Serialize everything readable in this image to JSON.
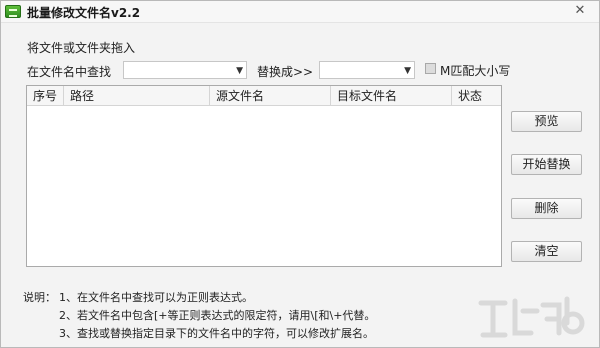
{
  "window": {
    "title": "批量修改文件名v2.2",
    "close_glyph": "✕"
  },
  "drop_hint": "将文件或文件夹拖入",
  "search": {
    "label": "在文件名中查找",
    "value": "",
    "arrow": "▼"
  },
  "replace": {
    "label": "替换成>>",
    "value": "",
    "arrow": "▼"
  },
  "match_case": {
    "label": "M匹配大小写",
    "checked": false
  },
  "table": {
    "columns": [
      "序号",
      "路径",
      "源文件名",
      "目标文件名",
      "状态"
    ],
    "rows": []
  },
  "buttons": {
    "preview": "预览",
    "start_replace": "开始替换",
    "delete": "删除",
    "clear": "清空"
  },
  "notes": {
    "heading": "说明：",
    "lines": [
      "1、在文件名中查找可以为正则表达式。",
      "2、若文件名中包含[+等正则表达式的限定符，请用\\[和\\+代替。",
      "3、查找或替换指定目录下的文件名中的字符，可以修改扩展名。"
    ]
  },
  "icons": {
    "app": "green-app-icon",
    "close": "close-icon",
    "watermark": "watermark-logo"
  }
}
